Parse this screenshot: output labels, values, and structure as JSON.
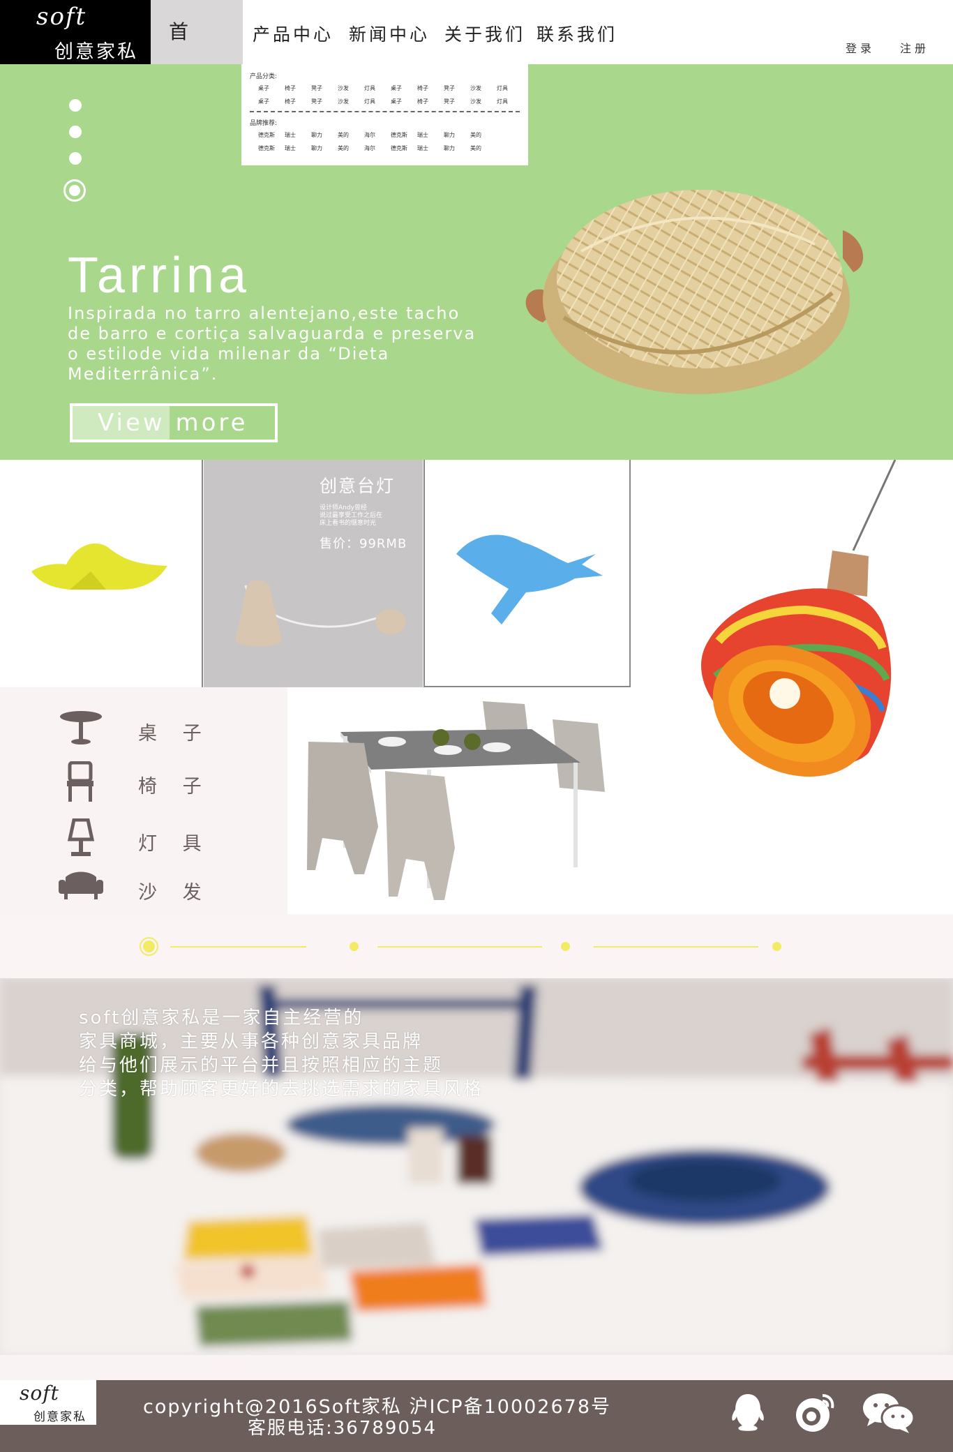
{
  "brand": {
    "logo_en": "soft",
    "logo_cn": "创意家私"
  },
  "nav": {
    "home": "首 页",
    "items": [
      "产品中心",
      "新闻中心",
      "关于我们",
      "联系我们"
    ],
    "login": "登录",
    "register": "注册"
  },
  "dropdown": {
    "category_label": "产品分类:",
    "category_rows": [
      [
        "桌子",
        "椅子",
        "凳子",
        "沙发",
        "灯具",
        "桌子",
        "椅子",
        "凳子",
        "沙发",
        "灯具"
      ],
      [
        "桌子",
        "椅子",
        "凳子",
        "沙发",
        "灯具",
        "桌子",
        "椅子",
        "凳子",
        "沙发",
        "灯具"
      ]
    ],
    "brand_label": "品牌推荐:",
    "brand_rows": [
      [
        "德克斯",
        "瑞士",
        "聊力",
        "美的",
        "海尔",
        "德克斯",
        "瑞士",
        "聊力",
        "美的"
      ],
      [
        "德克斯",
        "瑞士",
        "聊力",
        "美的",
        "海尔",
        "德克斯",
        "瑞士",
        "聊力",
        "美的"
      ]
    ]
  },
  "hero": {
    "title": "Tarrina",
    "description": "Inspirada no tarro alentejano,este tacho\nde barro e cortiça salvaguarda e preserva\n o estilode vida milenar da  “Dieta\nMediterrânica”.",
    "button": "View more",
    "slides_total": 4,
    "active_slide": 4
  },
  "featured_lamp": {
    "title": "创意台灯",
    "description": "设计师Andy曾经\n说过最享受工作之后在\n床上看书的惬意时光",
    "price": "售价：99RMB"
  },
  "categories": [
    {
      "label": "桌 子",
      "icon": "table-icon"
    },
    {
      "label": "椅 子",
      "icon": "chair-icon"
    },
    {
      "label": "灯 具",
      "icon": "lamp-icon"
    },
    {
      "label": "沙 发",
      "icon": "sofa-icon"
    }
  ],
  "about": {
    "text": "soft创意家私是一家自主经营的\n家具商城，主要从事各种创意家具品牌\n给与他们展示的平台并且按照相应的主题\n分类，帮助顾客更好的去挑选需求的家具风格"
  },
  "footer": {
    "logo_en": "soft",
    "logo_cn": "创意家私",
    "copyright": "copyright@2016Soft家私 沪ICP备10002678号",
    "hotline": "客服电话:36789054",
    "social": [
      "qq-icon",
      "weibo-icon",
      "wechat-icon"
    ]
  },
  "colors": {
    "hero_green": "#a9d88c",
    "accent_yellow": "#f3ea66",
    "footer_brown": "#6b5e5b"
  }
}
